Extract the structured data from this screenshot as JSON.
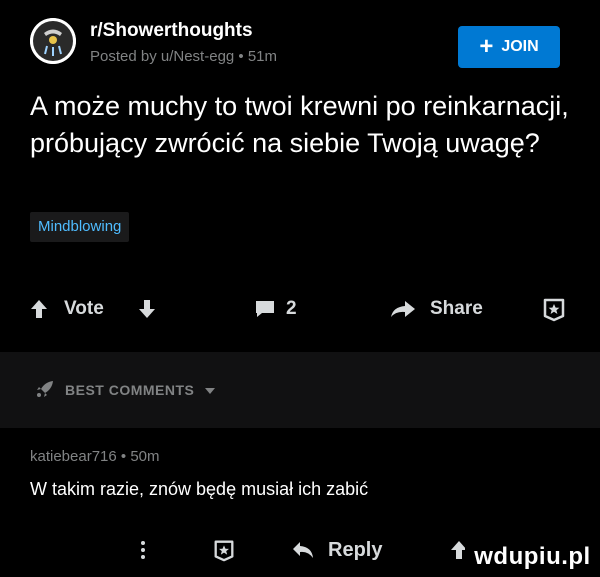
{
  "post": {
    "subreddit": "r/Showerthoughts",
    "meta": "Posted by u/Nest-egg • 51m",
    "join_label": "JOIN",
    "title": "A może muchy to twoi krewni po reinkarnacji, próbujący zwrócić na siebie Twoją uwagę?",
    "flair": "Mindblowing"
  },
  "actions": {
    "vote_label": "Vote",
    "comment_count": "2",
    "share_label": "Share"
  },
  "comments_header": {
    "label": "BEST COMMENTS"
  },
  "comment": {
    "meta": "katiebear716 • 50m",
    "body": "W takim razie, znów będę musiał ich zabić",
    "reply_label": "Reply"
  },
  "watermark": "wdupiu.pl",
  "colors": {
    "accent": "#0079d3",
    "flair_text": "#4fbcff",
    "background": "#000000"
  },
  "icons": [
    "subreddit-avatar-icon",
    "plus-icon",
    "upvote-icon",
    "downvote-icon",
    "comment-icon",
    "share-arrow-icon",
    "award-icon",
    "rocket-icon",
    "chevron-down-icon",
    "more-dots-icon",
    "reply-icon"
  ]
}
